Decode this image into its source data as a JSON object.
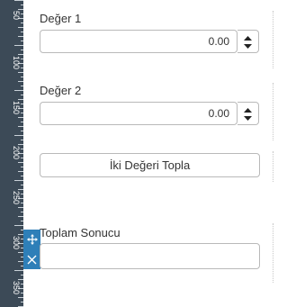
{
  "ruler": {
    "marks": [
      "50",
      "100",
      "150",
      "200",
      "250",
      "300",
      "350"
    ]
  },
  "form": {
    "value1": {
      "label": "Değer 1",
      "value": "0.00"
    },
    "value2": {
      "label": "Değer 2",
      "value": "0.00"
    },
    "sum_button_label": "İki Değeri Topla",
    "result": {
      "label": "Toplam Sonucu",
      "value": ""
    }
  },
  "colors": {
    "ruler_bg": "#3c4a57",
    "handle_bg": "#2e7fb8",
    "border": "#b9b9b9"
  },
  "icons": {
    "handle_move": "move-icon",
    "handle_close": "close-icon",
    "spinner": "spinner-arrows-icon"
  }
}
